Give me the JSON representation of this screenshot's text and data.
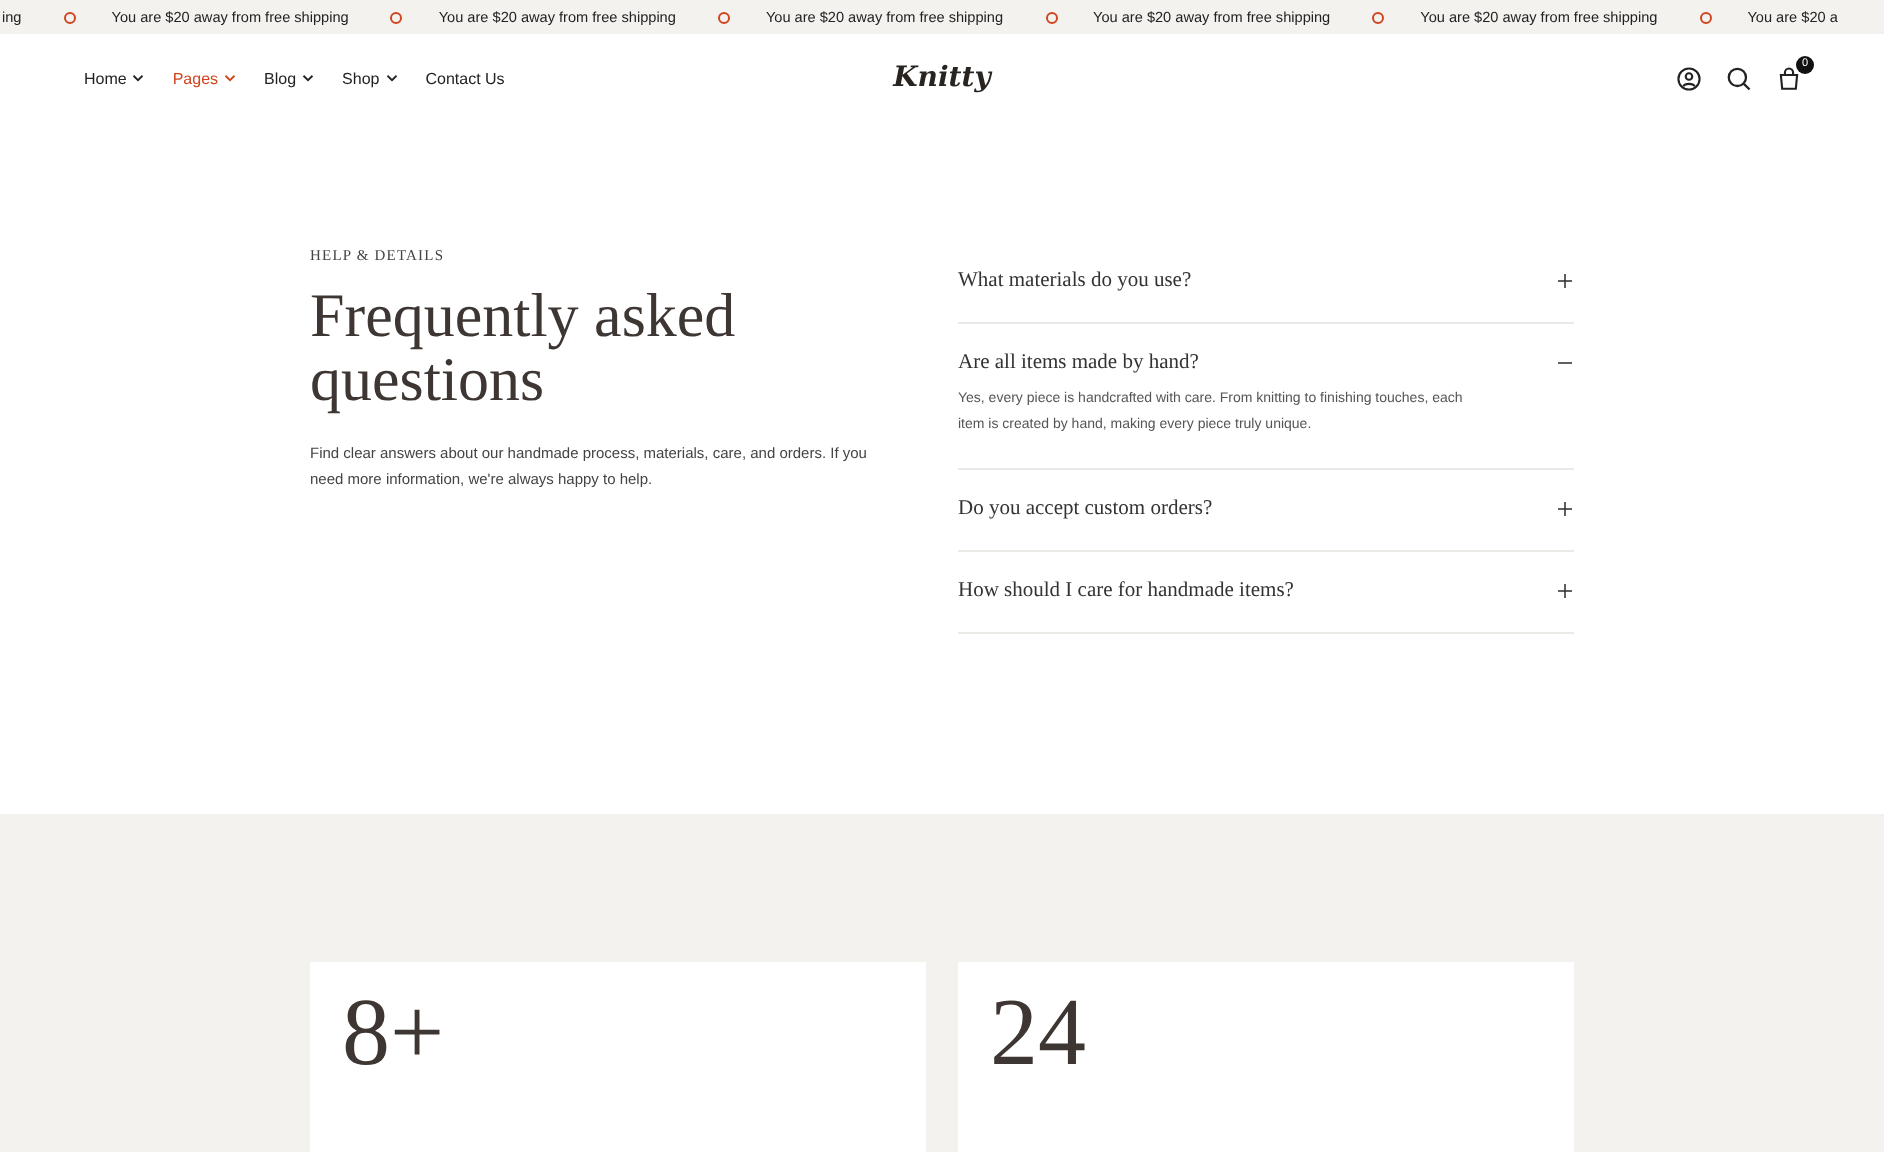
{
  "announcement_bar": {
    "items": [
      {
        "text": "ing",
        "dot": false
      },
      {
        "text": "You are $20 away from free shipping",
        "dot": true
      },
      {
        "text": "You are $20 away from free shipping",
        "dot": true
      },
      {
        "text": "You are $20 away from free shipping",
        "dot": true
      },
      {
        "text": "You are $20 away from free shipping",
        "dot": true
      },
      {
        "text": "You are $20 away from free shipping",
        "dot": true
      },
      {
        "text": "You are $20 a",
        "dot": true
      }
    ]
  },
  "header": {
    "nav": [
      {
        "label": "Home",
        "dropdown": true,
        "selected": false
      },
      {
        "label": "Pages",
        "dropdown": true,
        "selected": true
      },
      {
        "label": "Blog",
        "dropdown": true,
        "selected": false
      },
      {
        "label": "Shop",
        "dropdown": true,
        "selected": false
      },
      {
        "label": "Contact Us",
        "dropdown": false,
        "selected": false
      }
    ],
    "logo": "Knitty",
    "cart_count": "0"
  },
  "faq": {
    "eyebrow": "HELP & DETAILS",
    "title": "Frequently asked questions",
    "intro": "Find clear answers about our handmade process, materials, care, and orders. If you need more information, we're always happy to help.",
    "items": [
      {
        "question": "What materials do you use?",
        "expanded": false
      },
      {
        "question": "Are all items made by hand?",
        "expanded": true,
        "answer": "Yes, every piece is handcrafted with care. From knitting to finishing touches, each item is created by hand, making every piece truly unique."
      },
      {
        "question": "Do you accept custom orders?",
        "expanded": false
      },
      {
        "question": "How should I care for handmade items?",
        "expanded": false
      }
    ]
  },
  "stats": [
    {
      "value": "8+"
    },
    {
      "value": "24"
    }
  ]
}
